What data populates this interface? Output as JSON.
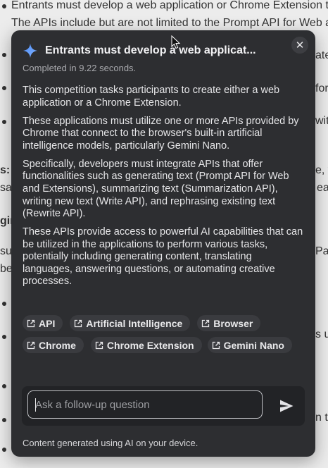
{
  "background": {
    "line1": "Entrants must develop a web application or Chrome Extension t",
    "line2": "The APIs include but are not limited to the Prompt API for Web a",
    "frag_ate": "ate",
    "frag_for": "for",
    "frag_wit": "wit",
    "frag_s_if": "s: if",
    "frag_sag": "sag",
    "frag_e_comma": "e, y",
    "frag_ea": "ea",
    "frag_gin": "gin",
    "frag_sub": "sub",
    "frag_par": "Par",
    "frag_bel": "bel",
    "frag_s_us": "s us",
    "frag_n_t": "n t"
  },
  "panel": {
    "title": "Entrants must develop a web applicat...",
    "timing": "Completed in 9.22 seconds.",
    "paragraphs": [
      "This competition tasks participants to create either a web application or a Chrome Extension.",
      "These applications must utilize one or more APIs provided by Chrome that connect to the browser's built-in artificial intelligence models, particularly Gemini Nano.",
      "Specifically, developers must integrate APIs that offer functionalities such as generating text (Prompt API for Web and Extensions), summarizing text (Summarization API), writing new text (Write API), and rephrasing existing text (Rewrite API).",
      "These APIs provide access to powerful AI capabilities that can be utilized in the applications to perform various tasks, potentially including generating content, translating languages, answering questions, or automating creative processes."
    ],
    "tags": [
      "API",
      "Artificial Intelligence",
      "Browser",
      "Chrome",
      "Chrome Extension",
      "Gemini Nano"
    ],
    "followup_placeholder": "Ask a follow-up question",
    "footer": "Content generated using AI on your device.",
    "close_symbol": "✕"
  },
  "colors": {
    "panel_bg": "#2d2e31",
    "tag_bg": "#3a3b3f",
    "spark_gradient_start": "#4f8df7",
    "spark_gradient_end": "#7fb2ff",
    "page_bg": "#ececec"
  },
  "icons": {
    "header": "sparkle-icon",
    "close": "close-icon",
    "tag": "external-link-icon",
    "send": "send-icon"
  }
}
